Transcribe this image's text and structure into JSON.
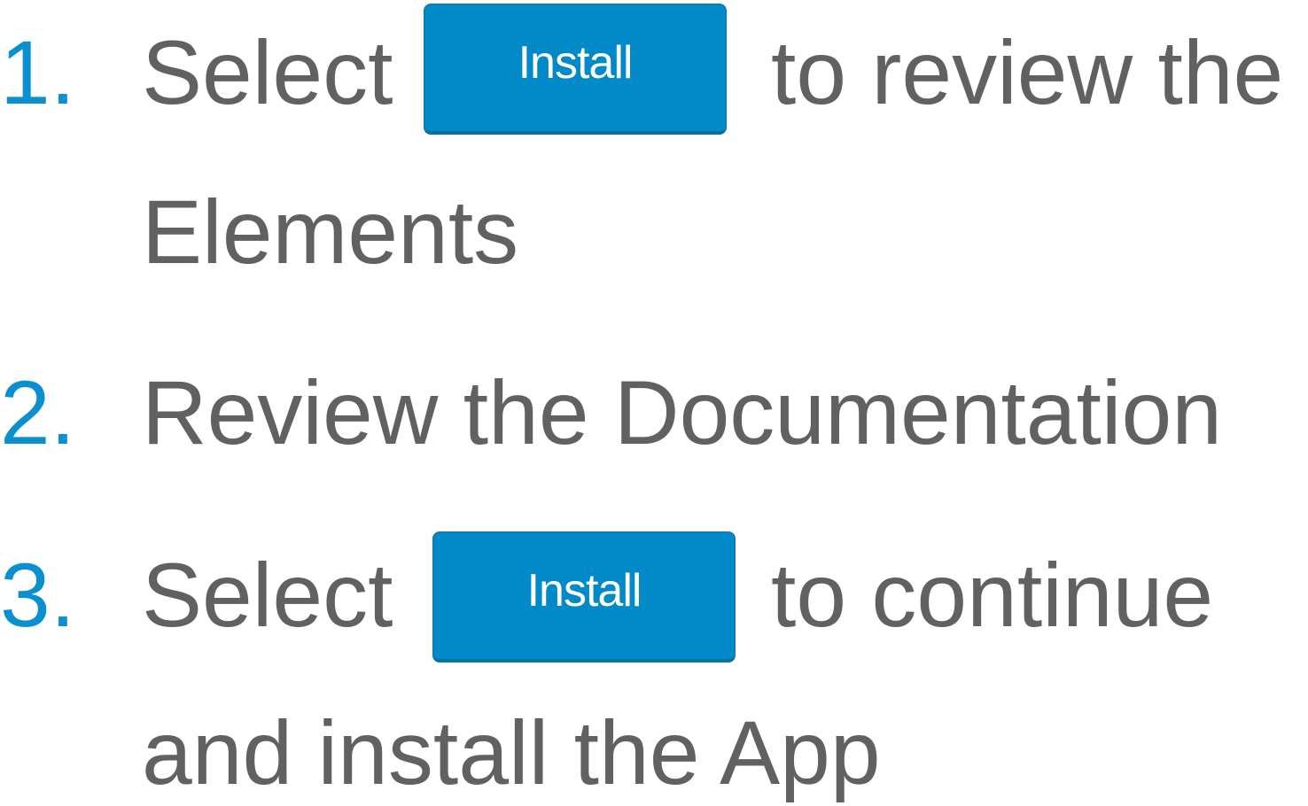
{
  "steps": [
    {
      "number": "1.",
      "before": "Select",
      "button_label": "Install",
      "after": "to review the",
      "continuation": "Elements"
    },
    {
      "number": "2.",
      "text": "Review the Documentation"
    },
    {
      "number": "3.",
      "before": "Select",
      "button_label": "Install",
      "after": "to continue",
      "continuation": "and install the App"
    }
  ],
  "colors": {
    "step_number": "#0a8fd0",
    "body_text": "#616161",
    "button_bg": "#0189c8",
    "button_text": "#ffffff"
  }
}
